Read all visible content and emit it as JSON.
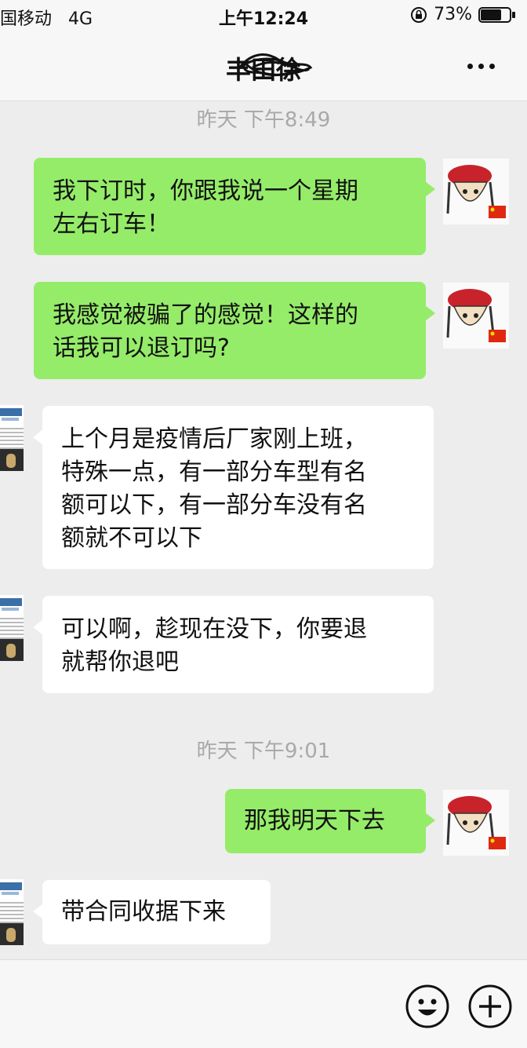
{
  "status_bar": {
    "carrier": "国移动",
    "network": "4G",
    "time": "上午12:24",
    "battery_percent": "73%",
    "battery_level": 0.73
  },
  "nav": {
    "title": "丰田徐",
    "more_icon": "more-icon"
  },
  "messages": [
    {
      "type": "timestamp",
      "text": "昨天  下午8:49"
    },
    {
      "type": "bubble",
      "side": "out",
      "text": "我下订时，你跟我说一个星期\n左右订车！"
    },
    {
      "type": "bubble",
      "side": "out",
      "text": "我感觉被骗了的感觉！这样的\n话我可以退订吗?"
    },
    {
      "type": "bubble",
      "side": "in",
      "text": "上个月是疫情后厂家刚上班，\n特殊一点，有一部分车型有名\n额可以下，有一部分车没有名\n额就不可以下"
    },
    {
      "type": "bubble",
      "side": "in",
      "text": "可以啊，趁现在没下，你要退\n就帮你退吧"
    },
    {
      "type": "timestamp",
      "text": "昨天  下午9:01"
    },
    {
      "type": "bubble",
      "side": "out",
      "text": "那我明天下去"
    },
    {
      "type": "bubble",
      "side": "in",
      "text": "带合同收据下来"
    }
  ],
  "bottom_bar": {
    "emoji_icon": "emoji-icon",
    "plus_icon": "plus-icon"
  },
  "colors": {
    "outgoing_bubble": "#95ec69",
    "incoming_bubble": "#ffffff",
    "background": "#ededed"
  }
}
